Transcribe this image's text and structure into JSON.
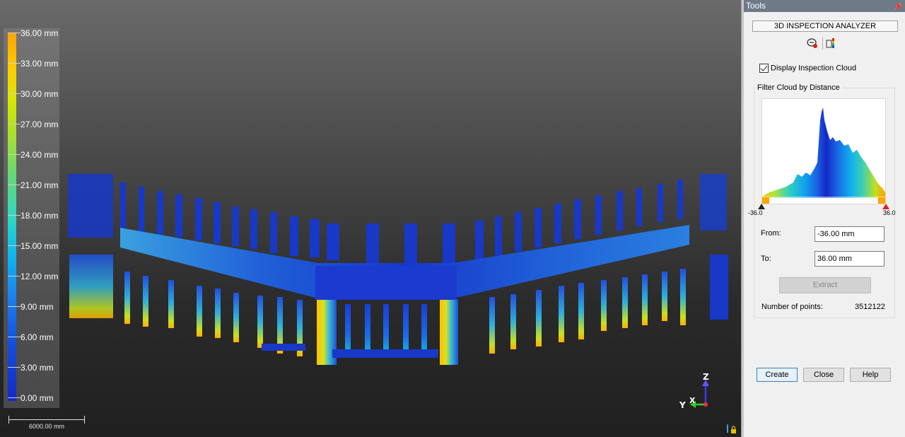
{
  "viewport": {
    "legend": {
      "labels": [
        "36.00 mm",
        "33.00 mm",
        "30.00 mm",
        "27.00 mm",
        "24.00 mm",
        "21.00 mm",
        "18.00 mm",
        "15.00 mm",
        "12.00 mm",
        "9.00 mm",
        "6.00 mm",
        "3.00 mm",
        "0.00 mm"
      ],
      "colors": [
        "#ffa400",
        "#ffcc00",
        "#d8e800",
        "#a8e030",
        "#6ad870",
        "#30d8c0",
        "#10b8f0",
        "#1a80f0",
        "#1450e0",
        "#1428c8"
      ]
    },
    "scale_bar": {
      "label": "6000.00 mm"
    },
    "axis_gizmo": {
      "z": "Z",
      "y": "Y",
      "x": "X"
    },
    "corner_icon": "info-lock-icon"
  },
  "tools": {
    "header": "Tools",
    "pin_icon": "pin-icon",
    "analyzer_title": "3D INSPECTION ANALYZER",
    "icons": [
      "inspection-settings-icon",
      "color-map-icon"
    ],
    "display_cloud_label": "Display Inspection Cloud",
    "display_cloud_checked": true,
    "filter_title": "Filter Cloud by Distance",
    "histogram": {
      "min_label": "-36.0",
      "max_label": "36.0"
    },
    "from_label": "From:",
    "from_value": "-36.00 mm",
    "to_label": "To:",
    "to_value": "36.00 mm",
    "extract_label": "Extract",
    "points_label": "Number of points:",
    "points_value": "3512122",
    "create_label": "Create",
    "close_label": "Close",
    "help_label": "Help"
  }
}
